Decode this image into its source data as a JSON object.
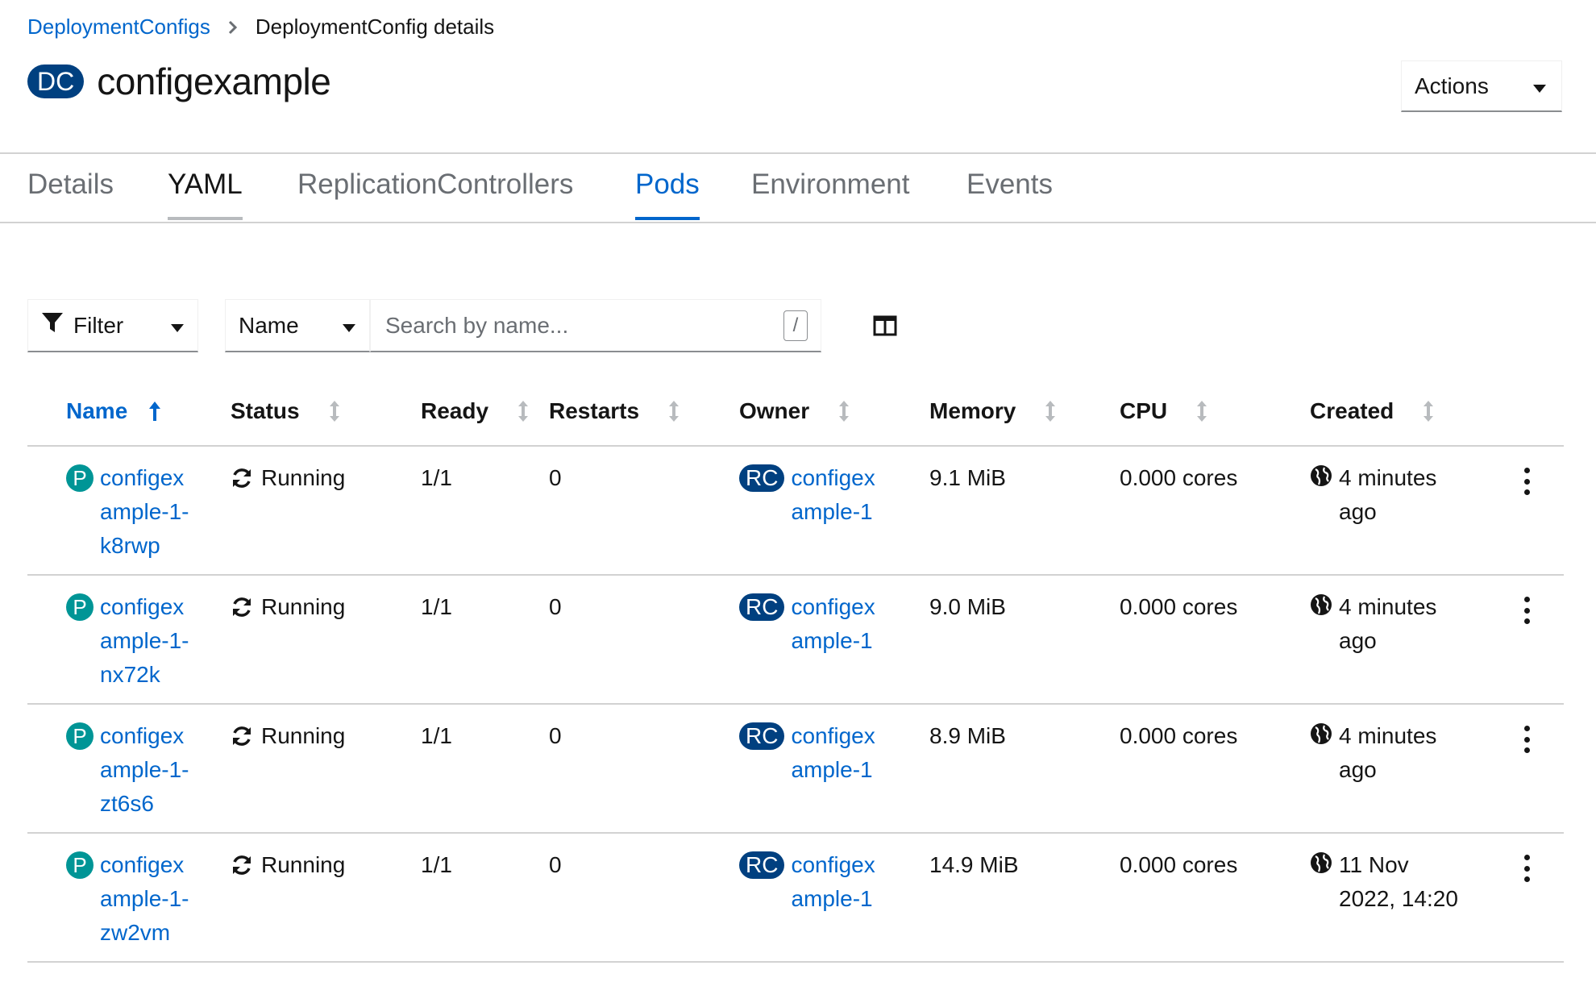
{
  "breadcrumb": {
    "parent": "DeploymentConfigs",
    "current": "DeploymentConfig details"
  },
  "header": {
    "kind_badge": "DC",
    "title": "configexample",
    "actions_label": "Actions"
  },
  "tabs": [
    {
      "label": "Details"
    },
    {
      "label": "YAML"
    },
    {
      "label": "ReplicationControllers"
    },
    {
      "label": "Pods"
    },
    {
      "label": "Environment"
    },
    {
      "label": "Events"
    }
  ],
  "active_tab": "Pods",
  "toolbar": {
    "filter_label": "Filter",
    "name_select": "Name",
    "search_placeholder": "Search by name...",
    "search_hint": "/"
  },
  "table": {
    "columns": [
      "Name",
      "Status",
      "Ready",
      "Restarts",
      "Owner",
      "Memory",
      "CPU",
      "Created"
    ],
    "rows": [
      {
        "pod_badge": "P",
        "name": "configexample-1-k8rwp",
        "status": "Running",
        "ready": "1/1",
        "restarts": "0",
        "owner_badge": "RC",
        "owner": "configexample-1",
        "memory": "9.1 MiB",
        "cpu": "0.000 cores",
        "created": "4 minutes ago"
      },
      {
        "pod_badge": "P",
        "name": "configexample-1-nx72k",
        "status": "Running",
        "ready": "1/1",
        "restarts": "0",
        "owner_badge": "RC",
        "owner": "configexample-1",
        "memory": "9.0 MiB",
        "cpu": "0.000 cores",
        "created": "4 minutes ago"
      },
      {
        "pod_badge": "P",
        "name": "configexample-1-zt6s6",
        "status": "Running",
        "ready": "1/1",
        "restarts": "0",
        "owner_badge": "RC",
        "owner": "configexample-1",
        "memory": "8.9 MiB",
        "cpu": "0.000 cores",
        "created": "4 minutes ago"
      },
      {
        "pod_badge": "P",
        "name": "configexample-1-zw2vm",
        "status": "Running",
        "ready": "1/1",
        "restarts": "0",
        "owner_badge": "RC",
        "owner": "configexample-1",
        "memory": "14.9 MiB",
        "cpu": "0.000 cores",
        "created": "11 Nov 2022, 14:20"
      }
    ]
  },
  "colors": {
    "link": "#0066cc",
    "badge_dark": "#004080",
    "pod_badge": "#009596",
    "border": "#d2d2d2"
  },
  "icons": [
    "chevron-right-icon",
    "caret-down-icon",
    "filter-icon",
    "columns-icon",
    "sort-asc-icon",
    "sort-icon",
    "sync-icon",
    "globe-icon",
    "kebab-icon"
  ]
}
